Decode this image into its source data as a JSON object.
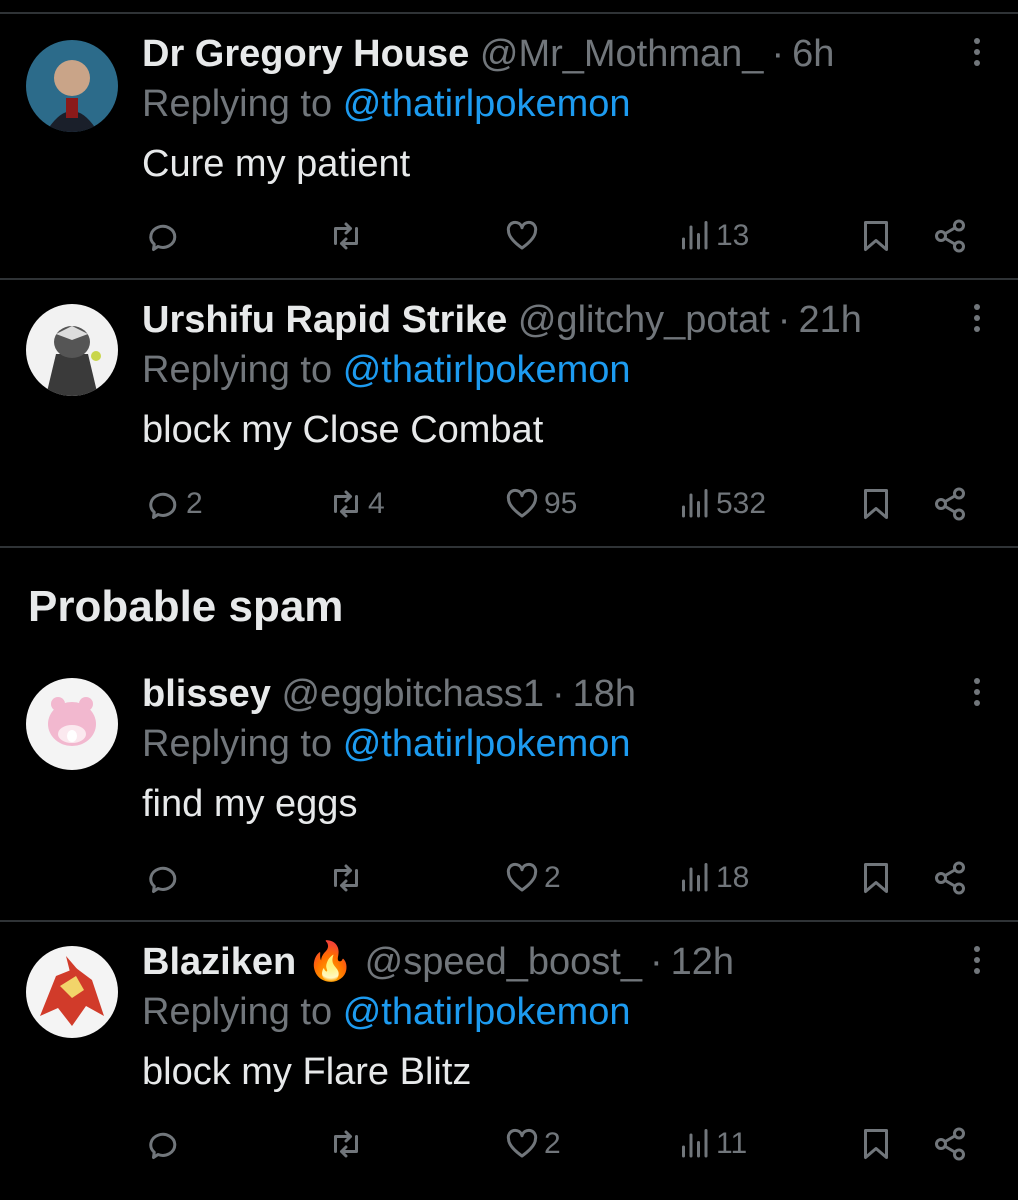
{
  "replying_label": "Replying to",
  "section": {
    "title": "Probable spam"
  },
  "tweets": [
    {
      "name": "Dr Gregory House",
      "handle": "@Mr_Mothman_",
      "time": "6h",
      "mention": "@thatirlpokemon",
      "text": "Cure my patient",
      "replies": "",
      "retweets": "",
      "likes": "",
      "views": "13"
    },
    {
      "name": "Urshifu Rapid Strike",
      "handle": "@glitchy_potat",
      "time": "21h",
      "mention": "@thatirlpokemon",
      "text": "block my Close Combat",
      "replies": "2",
      "retweets": "4",
      "likes": "95",
      "views": "532"
    },
    {
      "name": "blissey",
      "handle": "@eggbitchass1",
      "time": "18h",
      "mention": "@thatirlpokemon",
      "text": "find my eggs",
      "replies": "",
      "retweets": "",
      "likes": "2",
      "views": "18"
    },
    {
      "name": "Blaziken",
      "emoji": "🔥",
      "handle": "@speed_boost_",
      "time": "12h",
      "mention": "@thatirlpokemon",
      "text": "block my Flare Blitz",
      "replies": "",
      "retweets": "",
      "likes": "2",
      "views": "11"
    }
  ],
  "colors": {
    "background": "#000000",
    "text": "#e7e9ea",
    "muted": "#71767b",
    "link": "#1d9bf0",
    "divider": "#2f3336"
  },
  "icons": [
    "reply-icon",
    "retweet-icon",
    "like-icon",
    "views-icon",
    "bookmark-icon",
    "share-icon",
    "more-icon"
  ]
}
